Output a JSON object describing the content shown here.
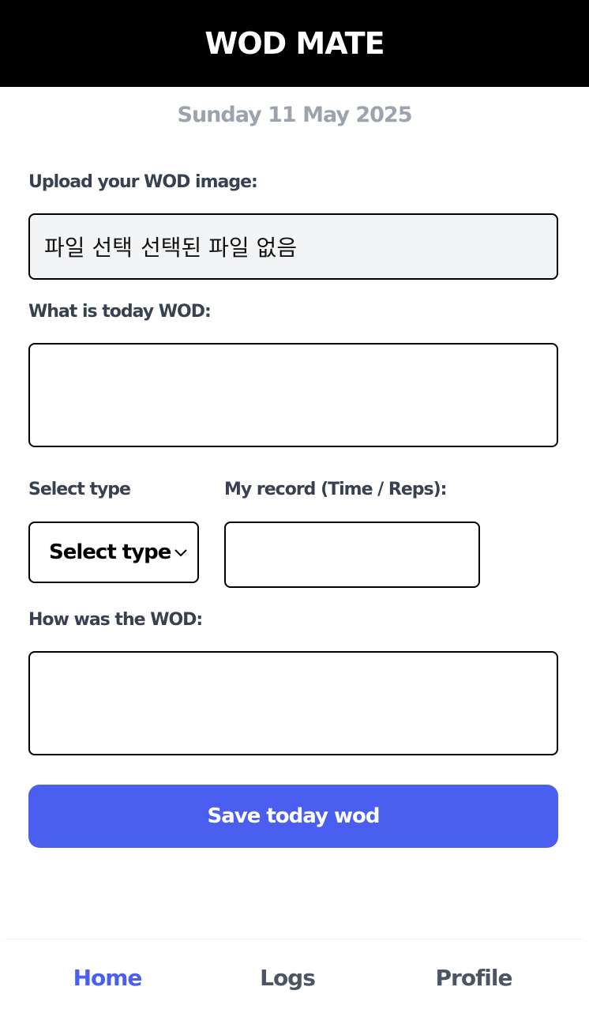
{
  "header": {
    "title": "WOD MATE"
  },
  "date": "Sunday 11 May 2025",
  "form": {
    "upload_label": "Upload your WOD image:",
    "file_button": "파일 선택",
    "file_status": "선택된 파일 없음",
    "wod_label": "What is today WOD:",
    "wod_value": "",
    "type_label": "Select type",
    "type_selected": "Select type",
    "record_label": "My record (Time / Reps):",
    "record_value": "",
    "review_label": "How was the WOD:",
    "review_value": "",
    "save_label": "Save today wod"
  },
  "nav": {
    "items": [
      {
        "label": "Home",
        "active": true
      },
      {
        "label": "Logs",
        "active": false
      },
      {
        "label": "Profile",
        "active": false
      }
    ]
  },
  "colors": {
    "header_bg": "#000000",
    "accent": "#4a5ff0",
    "label": "#374151",
    "date": "#9ca3af",
    "file_bg": "#f3f4f6"
  },
  "icons": {
    "select_arrow": "chevron-down-icon"
  }
}
